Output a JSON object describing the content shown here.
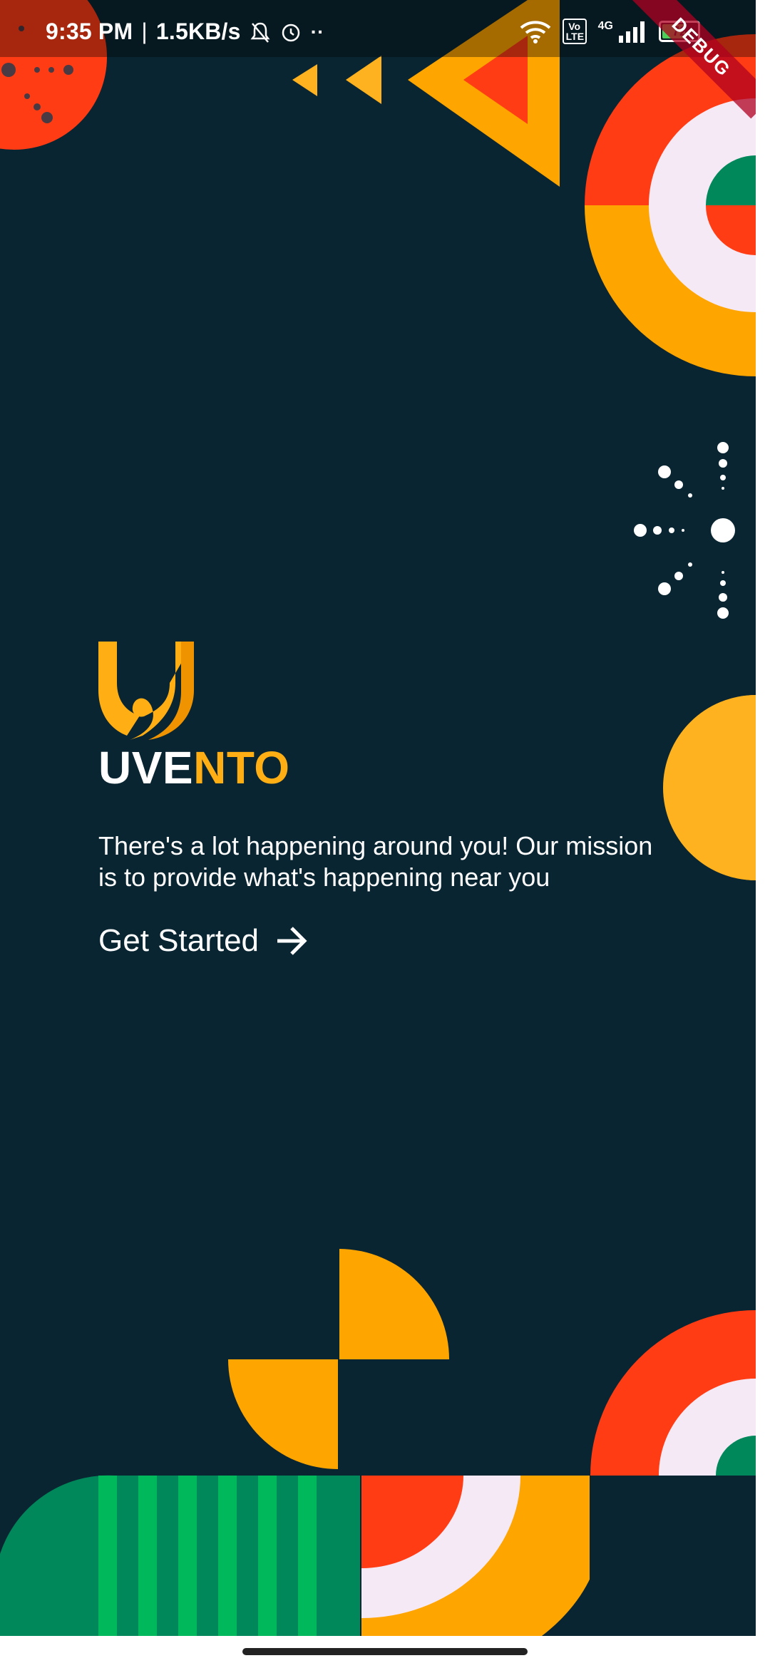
{
  "status_bar": {
    "time": "9:35 PM",
    "speed": "1.5KB/s",
    "network": "4G",
    "volte": "Vo LTE",
    "battery_level": "72",
    "battery_fraction": 0.72,
    "icons": [
      "bell-off-icon",
      "alarm-icon",
      "wifi-icon",
      "volte-icon",
      "signal-icon",
      "battery-icon"
    ]
  },
  "debug_banner": "DEBUG",
  "brand": {
    "part1": "UVE",
    "part2": "NTO",
    "accent": "#ffae14"
  },
  "tagline": "There's a lot happening around you! Our mission is to provide what's happening near you",
  "cta": {
    "label": "Get Started",
    "icon": "arrow-right-icon"
  },
  "colors": {
    "background": "#0a2532",
    "orange": "#ffa500",
    "red": "#ff3c14",
    "green": "#00875a",
    "light_green": "#00b85c",
    "cream": "#f5e9f5"
  }
}
